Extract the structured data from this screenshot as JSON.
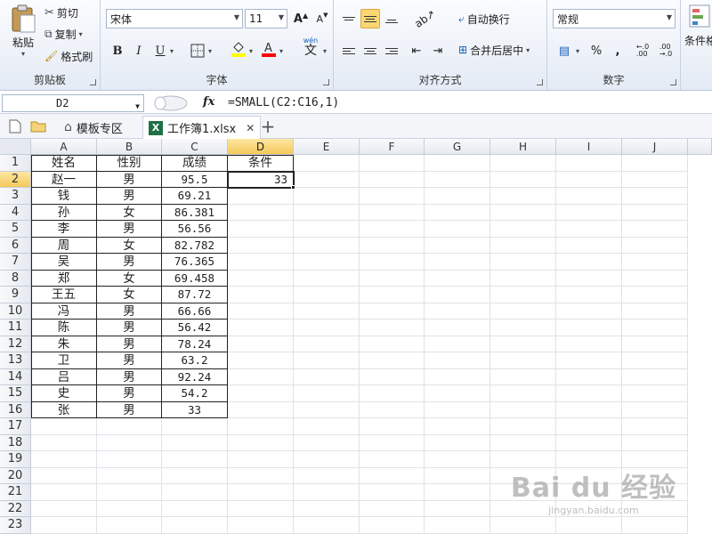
{
  "ribbon": {
    "clipboard": {
      "paste_label": "粘贴",
      "cut_label": "剪切",
      "copy_label": "复制",
      "format_painter_label": "格式刷",
      "group_label": "剪贴板"
    },
    "font": {
      "font_name": "宋体",
      "font_size": "11",
      "grow_label": "A",
      "shrink_label": "A",
      "bold_label": "B",
      "italic_label": "I",
      "underline_label": "U",
      "phonetic_label": "wén",
      "phonetic_char": "文",
      "group_label": "字体"
    },
    "alignment": {
      "wrap_text_label": "自动换行",
      "merge_center_label": "合并后居中",
      "group_label": "对齐方式"
    },
    "number": {
      "format_value": "常规",
      "percent_label": "%",
      "comma_label": ",",
      "group_label": "数字"
    },
    "styles": {
      "conditional_label": "条件格"
    }
  },
  "formula_bar": {
    "name_box": "D2",
    "fx_label": "fx",
    "formula": "=SMALL(C2:C16,1)"
  },
  "tabs": {
    "template_tab": "模板专区",
    "workbook_tab": "工作簿1.xlsx",
    "excel_icon_letter": "X",
    "add_tab": "+",
    "close_tab": "✕"
  },
  "sheet": {
    "columns": [
      "A",
      "B",
      "C",
      "D",
      "E",
      "F",
      "G",
      "H",
      "I",
      "J"
    ],
    "rows": [
      "1",
      "2",
      "3",
      "4",
      "5",
      "6",
      "7",
      "8",
      "9",
      "10",
      "11",
      "12",
      "13",
      "14",
      "15",
      "16",
      "17",
      "18",
      "19",
      "20",
      "21",
      "22",
      "23"
    ],
    "header_row": {
      "name": "姓名",
      "gender": "性别",
      "score": "成绩",
      "condition": "条件"
    },
    "data": [
      {
        "name": "赵一",
        "gender": "男",
        "score": "95.5"
      },
      {
        "name": "钱",
        "gender": "男",
        "score": "69.21"
      },
      {
        "name": "孙",
        "gender": "女",
        "score": "86.381"
      },
      {
        "name": "李",
        "gender": "男",
        "score": "56.56"
      },
      {
        "name": "周",
        "gender": "女",
        "score": "82.782"
      },
      {
        "name": "吴",
        "gender": "男",
        "score": "76.365"
      },
      {
        "name": "郑",
        "gender": "女",
        "score": "69.458"
      },
      {
        "name": "王五",
        "gender": "女",
        "score": "87.72"
      },
      {
        "name": "冯",
        "gender": "男",
        "score": "66.66"
      },
      {
        "name": "陈",
        "gender": "男",
        "score": "56.42"
      },
      {
        "name": "朱",
        "gender": "男",
        "score": "78.24"
      },
      {
        "name": "卫",
        "gender": "男",
        "score": "63.2"
      },
      {
        "name": "吕",
        "gender": "男",
        "score": "92.24"
      },
      {
        "name": "史",
        "gender": "男",
        "score": "54.2"
      },
      {
        "name": "张",
        "gender": "男",
        "score": "33"
      }
    ],
    "d2_value": "33",
    "selected_cell": "D2"
  },
  "watermark": {
    "logo": "Bai du 经验",
    "url": "jingyan.baidu.com"
  }
}
